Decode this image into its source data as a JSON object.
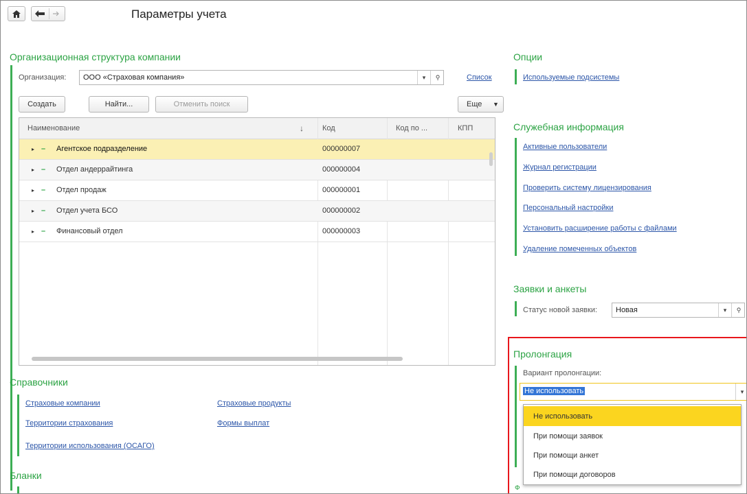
{
  "window": {
    "title": "Параметры учета"
  },
  "org_section": {
    "heading": "Организационная структура компании",
    "org_label": "Организация:",
    "org_value": "ООО «Страховая компания»",
    "list_link": "Список",
    "buttons": {
      "create": "Создать",
      "find": "Найти...",
      "cancel_search": "Отменить поиск",
      "more": "Еще"
    }
  },
  "table": {
    "columns": [
      "Наименование",
      "Код",
      "Код по ...",
      "КПП"
    ],
    "rows": [
      {
        "name": "Агентское подразделение",
        "code": "000000007"
      },
      {
        "name": "Отдел андеррайтинга",
        "code": "000000004"
      },
      {
        "name": "Отдел продаж",
        "code": "000000001"
      },
      {
        "name": "Отдел учета БСО",
        "code": "000000002"
      },
      {
        "name": "Финансовый отдел",
        "code": "000000003"
      }
    ],
    "selected_row": 0
  },
  "references": {
    "heading": "Справочники",
    "links": [
      "Страховые компании",
      "Территории страхования",
      "Территории использования (ОСАГО)",
      "Страховые продукты",
      "Формы выплат"
    ]
  },
  "blanks": {
    "heading": "Бланки"
  },
  "options": {
    "heading": "Опции",
    "links": [
      "Используемые подсистемы"
    ]
  },
  "service": {
    "heading": "Служебная информация",
    "links": [
      "Активные пользователи",
      "Журнал регистрации",
      "Проверить систему лицензирования",
      "Персональный настройки",
      "Установить расширение работы с файлами",
      "Удаление помеченных объектов"
    ]
  },
  "requests": {
    "heading": "Заявки и анкеты",
    "status_label": "Статус новой заявки:",
    "status_value": "Новая"
  },
  "prolongation": {
    "heading": "Пролонгация",
    "variant_label": "Вариант пролонгации:",
    "variant_value": "Не использовать",
    "options": [
      "Не использовать",
      "При помощи заявок",
      "При помощи анкет",
      "При помощи договоров"
    ],
    "highlight_color": "#e8161b"
  },
  "colors": {
    "accent": "#2ca344",
    "link": "#2b55a8",
    "selected_row": "#fbf0b4",
    "dropdown_selected": "#fbd51f"
  },
  "icons": {
    "home": "home-icon",
    "back": "arrow-left-icon",
    "forward": "arrow-right-icon",
    "open": "link-icon",
    "dropdown": "triangle-down-icon",
    "sort": "sort-down-icon"
  }
}
